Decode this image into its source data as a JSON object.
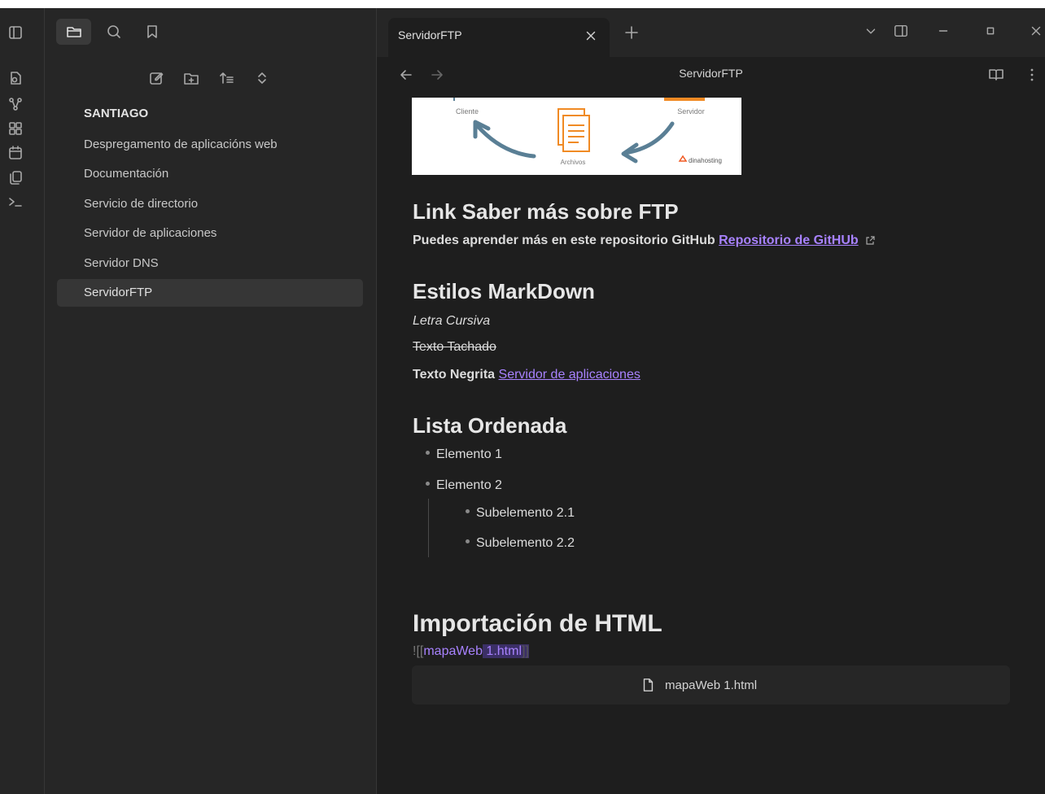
{
  "sidebar": {
    "vault_name": "SANTIAGO",
    "items": [
      {
        "label": "Despregamento de aplicacións web"
      },
      {
        "label": "Documentación"
      },
      {
        "label": "Servicio de directorio"
      },
      {
        "label": "Servidor de aplicaciones"
      },
      {
        "label": "Servidor DNS"
      },
      {
        "label": "ServidorFTP",
        "active": true
      }
    ]
  },
  "tabs": [
    {
      "label": "ServidorFTP",
      "active": true
    }
  ],
  "view": {
    "title": "ServidorFTP"
  },
  "diagram": {
    "client_label": "Cliente",
    "server_label": "Servidor",
    "files_label": "Archivos",
    "brand_label": "dinahosting"
  },
  "content": {
    "h_link": "Link Saber más sobre FTP",
    "link_para_text": "Puedes aprender más en este repositorio GitHub ",
    "link_para_link": "Repositorio de GitHUb",
    "h_styles": "Estilos MarkDown",
    "italic": "Letra Cursiva",
    "strike": "Texto Tachado",
    "bold": "Texto Negrita",
    "bold_link": "Servidor de aplicaciones",
    "h_list": "Lista Ordenada",
    "list": [
      {
        "label": "Elemento 1"
      },
      {
        "label": "Elemento 2"
      },
      {
        "label": "Subelemento 2.1"
      },
      {
        "label": "Subelemento 2.2"
      }
    ],
    "h_import": "Importación de HTML",
    "embed_prefix": "![[",
    "embed_name_a": "mapaWeb",
    "embed_name_b": " 1.html",
    "embed_suffix": "]]",
    "embed_file": "mapaWeb 1.html"
  },
  "colors": {
    "accent": "#a882ff",
    "background": "#1e1e1e",
    "sidebar": "#262626"
  }
}
